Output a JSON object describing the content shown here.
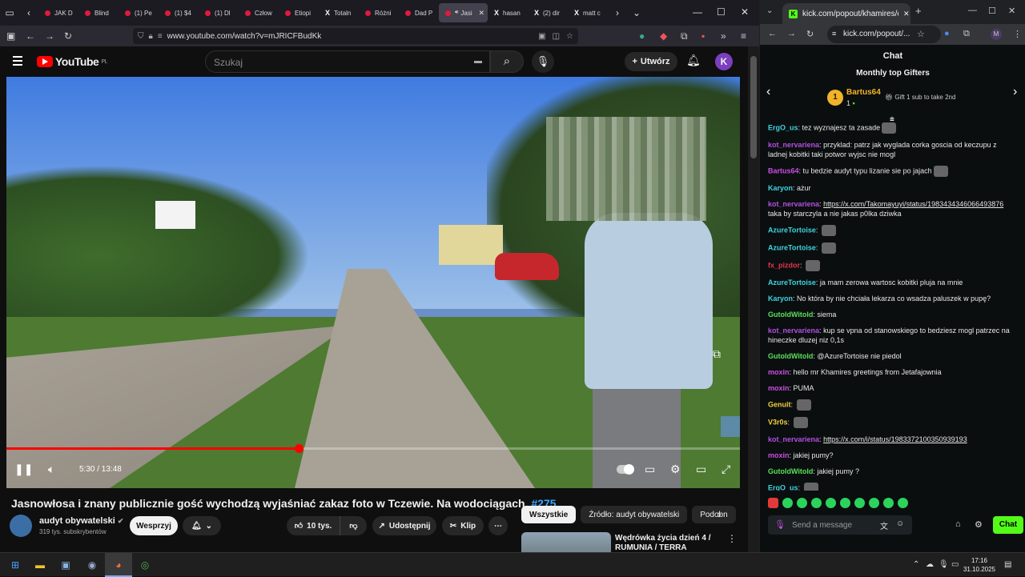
{
  "firefox": {
    "tabs": [
      {
        "label": "JAK D",
        "favicon": "youtube-icon"
      },
      {
        "label": "Blind",
        "favicon": "youtube-icon"
      },
      {
        "label": "(1) Pe",
        "favicon": "youtube-icon"
      },
      {
        "label": "(1) $4",
        "favicon": "youtube-icon"
      },
      {
        "label": "(1) Dl",
        "favicon": "youtube-icon"
      },
      {
        "label": "Człow",
        "favicon": "youtube-icon"
      },
      {
        "label": "Etiopi",
        "favicon": "youtube-icon"
      },
      {
        "label": "Totaln",
        "favicon": "x-icon"
      },
      {
        "label": "Różni",
        "favicon": "youtube-icon"
      },
      {
        "label": "Dad P",
        "favicon": "youtube-icon"
      },
      {
        "label": "Jasi",
        "favicon": "youtube-icon",
        "active": true
      },
      {
        "label": "hasan",
        "favicon": "x-icon"
      },
      {
        "label": "(2) dir",
        "favicon": "x-icon"
      },
      {
        "label": "matt c",
        "favicon": "x-icon"
      }
    ],
    "url": "www.youtube.com/watch?v=mJRICFBudKk"
  },
  "youtube": {
    "logo_text": "YouTube",
    "logo_region": "PL",
    "search_placeholder": "Szukaj",
    "create_label": "Utwórz",
    "avatar_letter": "K",
    "player": {
      "time": "5:30 / 13:48",
      "progress_fraction": 0.398
    },
    "video_title": "Jasnowłosa i znany publicznie gość wychodzą wyjaśniać zakaz foto w Tczewie. Na wodociągach.",
    "video_tag": "#275",
    "channel_name": "audyt obywatelski",
    "channel_subs": "319 tys. subskrybentów",
    "support_label": "Wesprzyj",
    "likes": "10 tys.",
    "share_label": "Udostępnij",
    "clip_label": "Klip",
    "chips": [
      "Wszystkie",
      "Źródło: audyt obywatelski",
      "Podobn"
    ],
    "rec_title": "Wędrówka życia dzień 4 / RUMUNIA / TERRA BANATICA"
  },
  "chrome": {
    "tab_label": "kick.com/popout/khamires/cha",
    "url": "kick.com/popout/...",
    "profile_letter": "M"
  },
  "kick": {
    "header": "Chat",
    "gifters_title": "Monthly top Gifters",
    "top_gifter_rank": "1",
    "top_gifter_name": "Bartus64",
    "top_gifter_count": "1",
    "gift_cta": "Gift 1 sub to take 2nd",
    "messages": [
      {
        "user": "ErgO_us",
        "color": "#3fd3e0",
        "text": "tez wyznajesz ta zasade",
        "emote": true
      },
      {
        "user": "kot_nervariena",
        "color": "#b04fe0",
        "text": "przyklad: patrz jak wyglada corka goscia od keczupu  z ladnej kobitki taki potwor wyjsc nie mogl"
      },
      {
        "user": "Bartus64",
        "color": "#c94fe0",
        "text": "tu bedzie audyt typu lizanie sie po jajach",
        "emote": true
      },
      {
        "user": "Karyon",
        "color": "#3fd3e0",
        "text": "ażur"
      },
      {
        "user": "kot_nervariena",
        "color": "#b04fe0",
        "link": "https://x.com/Takomayuyi/status/1983434346066493876",
        "text": "taka by starczyla a nie jakas p0lka dziwka"
      },
      {
        "user": "AzureTortoise",
        "color": "#3fd3e0",
        "text": "",
        "emote": true
      },
      {
        "user": "AzureTortoise",
        "color": "#3fd3e0",
        "text": "",
        "emote": true
      },
      {
        "user": "fx_pizdor",
        "color": "#e0354f",
        "text": "",
        "emote": true
      },
      {
        "user": "AzureTortoise",
        "color": "#3fd3e0",
        "text": "ja mam zerowa wartosc kobitki pluja na mnie"
      },
      {
        "user": "Karyon",
        "color": "#3fd3e0",
        "text": "No która by nie chciała lekarza co wsadza paluszek w pupę?"
      },
      {
        "user": "GutoldWitold",
        "color": "#5be05b",
        "text": "siema"
      },
      {
        "user": "kot_nervariena",
        "color": "#b04fe0",
        "text": "kup se vpna od stanowskiego to bedziesz mogl patrzec na hineczke dluzej niz 0,1s"
      },
      {
        "user": "GutoldWitold",
        "color": "#5be05b",
        "text": "@AzureTortoise nie piedol"
      },
      {
        "user": "moxin",
        "color": "#c94fe0",
        "text": "hello mr Khamires greetings from Jetafajownia"
      },
      {
        "user": "moxin",
        "color": "#c94fe0",
        "text": "PUMA"
      },
      {
        "user": "Genuit",
        "color": "#f0d040",
        "text": "",
        "emote": true
      },
      {
        "user": "V3r0s",
        "color": "#f0d040",
        "text": "",
        "emote": true
      },
      {
        "user": "kot_nervariena",
        "color": "#b04fe0",
        "link": "https://x.com/i/status/1983372100350939193",
        "text": ""
      },
      {
        "user": "moxin",
        "color": "#c94fe0",
        "text": "jakiej pumy?"
      },
      {
        "user": "GutoldWitold",
        "color": "#5be05b",
        "text": "jakiej pumy ?"
      },
      {
        "user": "ErgO_us",
        "color": "#3fd3e0",
        "text": "",
        "emote": true
      }
    ],
    "input_placeholder": "Send a message",
    "send_label": "Chat"
  },
  "taskbar": {
    "time": "17:16",
    "date": "31.10.2025"
  }
}
